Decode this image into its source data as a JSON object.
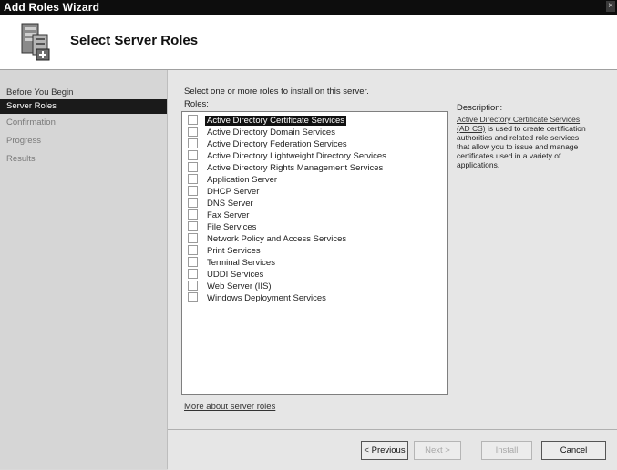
{
  "window": {
    "title": "Add Roles Wizard",
    "close_glyph": "×"
  },
  "header": {
    "title": "Select Server Roles",
    "icon": "server-roles-icon"
  },
  "sidebar": {
    "items": [
      {
        "label": "Before You Begin"
      },
      {
        "label": "Server Roles"
      },
      {
        "label": "Confirmation"
      },
      {
        "label": "Progress"
      },
      {
        "label": "Results"
      }
    ]
  },
  "main": {
    "instruction": "Select one or more roles to install on this server.",
    "roles_label": "Roles:",
    "roles": [
      "Active Directory Certificate Services",
      "Active Directory Domain Services",
      "Active Directory Federation Services",
      "Active Directory Lightweight Directory Services",
      "Active Directory Rights Management Services",
      "Application Server",
      "DHCP Server",
      "DNS Server",
      "Fax Server",
      "File Services",
      "Network Policy and Access Services",
      "Print Services",
      "Terminal Services",
      "UDDI Services",
      "Web Server (IIS)",
      "Windows Deployment Services"
    ],
    "selected_role_index": 0,
    "description_label": "Description:",
    "description_link": "Active Directory Certificate Services (AD CS)",
    "description_text": " is used to create certification authorities and related role services that allow you to issue and manage certificates used in a variety of applications.",
    "more_link": "More about server roles"
  },
  "footer": {
    "previous": "< Previous",
    "next": "Next >",
    "install": "Install",
    "cancel": "Cancel"
  }
}
